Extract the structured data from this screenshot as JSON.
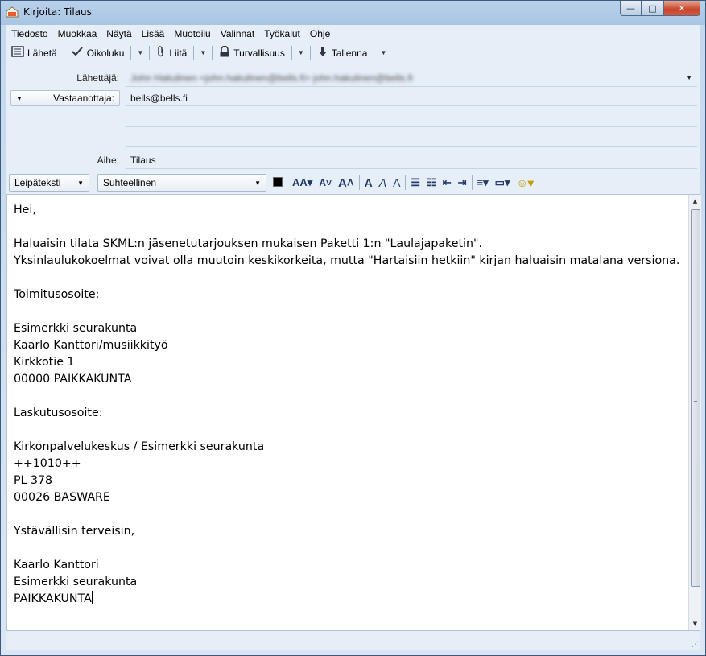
{
  "window": {
    "title": "Kirjoita: Tilaus",
    "minimize": "—",
    "maximize": "□",
    "close": "✕"
  },
  "menubar": {
    "items": [
      "Tiedosto",
      "Muokkaa",
      "Näytä",
      "Lisää",
      "Muotoilu",
      "Valinnat",
      "Työkalut",
      "Ohje"
    ]
  },
  "toolbar": {
    "send": "Lähetä",
    "spell": "Oikoluku",
    "attach": "Liitä",
    "security": "Turvallisuus",
    "save": "Tallenna"
  },
  "headers": {
    "from_label": "Lähettäjä:",
    "from_value": "John Hakulinen <john.hakulinen@bells.fi> john.hakulinen@bells.fi",
    "to_label": "Vastaanottaja:",
    "to_value": "bells@bells.fi",
    "subject_label": "Aihe:",
    "subject_value": "Tilaus"
  },
  "format": {
    "paragraph_style": "Leipäteksti",
    "font": "Suhteellinen"
  },
  "body": {
    "lines": [
      "Hei,",
      "",
      "Haluaisin tilata SKML:n jäsenetutarjouksen mukaisen Paketti 1:n \"Laulajapaketin\".",
      "Yksinlaulukokoelmat voivat olla muutoin keskikorkeita, mutta \"Hartaisiin hetkiin\" kirjan haluaisin matalana versiona.",
      "",
      "Toimitusosoite:",
      "",
      "Esimerkki seurakunta",
      "Kaarlo Kanttori/musiikkityö",
      "Kirkkotie 1",
      "00000 PAIKKAKUNTA",
      "",
      "Laskutusosoite:",
      "",
      "Kirkonpalvelukeskus / Esimerkki seurakunta",
      "++1010++",
      "PL 378",
      "00026 BASWARE",
      "",
      "Ystävällisin terveisin,",
      "",
      "Kaarlo Kanttori",
      "Esimerkki seurakunta",
      "PAIKKAKUNTA"
    ]
  }
}
